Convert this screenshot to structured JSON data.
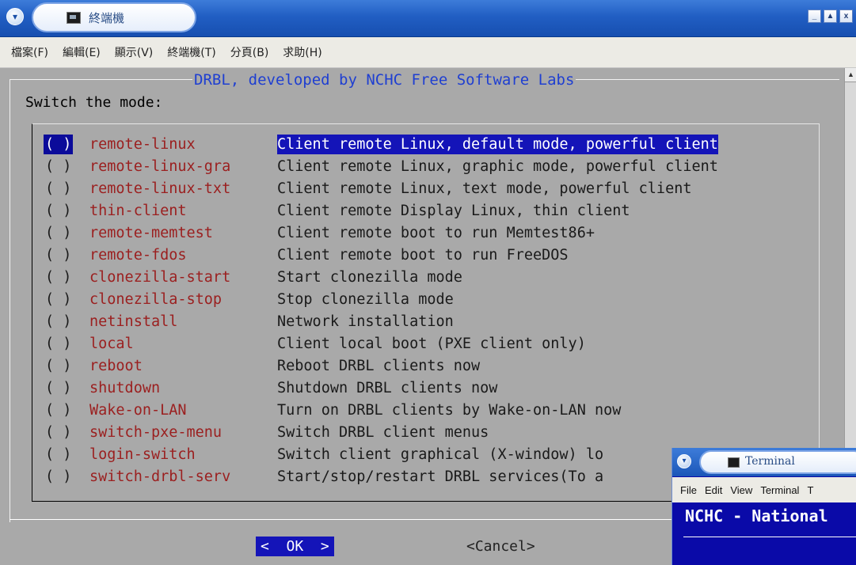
{
  "window": {
    "title": "終端機"
  },
  "menubar": {
    "items": [
      "檔案(F)",
      "編輯(E)",
      "顯示(V)",
      "終端機(T)",
      "分頁(B)",
      "求助(H)"
    ]
  },
  "dialog": {
    "frame_title": "DRBL, developed by NCHC Free Software Labs",
    "prompt": "Switch the mode:",
    "options": [
      {
        "radio": "( )",
        "tag": "remote-linux",
        "desc": "Client remote Linux, default mode, powerful client"
      },
      {
        "radio": "( )",
        "tag": "remote-linux-gra",
        "desc": "Client remote Linux, graphic mode, powerful client"
      },
      {
        "radio": "( )",
        "tag": "remote-linux-txt",
        "desc": "Client remote Linux, text mode, powerful client"
      },
      {
        "radio": "( )",
        "tag": "thin-client",
        "desc": "Client remote Display Linux, thin client"
      },
      {
        "radio": "( )",
        "tag": "remote-memtest",
        "desc": "Client remote boot to run Memtest86+"
      },
      {
        "radio": "( )",
        "tag": "remote-fdos",
        "desc": "Client remote boot to run FreeDOS"
      },
      {
        "radio": "( )",
        "tag": "clonezilla-start",
        "desc": "Start clonezilla mode"
      },
      {
        "radio": "( )",
        "tag": "clonezilla-stop",
        "desc": "Stop clonezilla mode"
      },
      {
        "radio": "( )",
        "tag": "netinstall",
        "desc": "Network installation"
      },
      {
        "radio": "( )",
        "tag": "local",
        "desc": "Client local boot (PXE client only)"
      },
      {
        "radio": "( )",
        "tag": "reboot",
        "desc": "Reboot DRBL clients now"
      },
      {
        "radio": "( )",
        "tag": "shutdown",
        "desc": "Shutdown DRBL clients now"
      },
      {
        "radio": "( )",
        "tag": "Wake-on-LAN",
        "desc": "Turn on DRBL clients by Wake-on-LAN now"
      },
      {
        "radio": "( )",
        "tag": "switch-pxe-menu",
        "desc": "Switch DRBL client menus"
      },
      {
        "radio": "( )",
        "tag": "login-switch",
        "desc": "Switch client graphical (X-window) lo"
      },
      {
        "radio": "( )",
        "tag": "switch-drbl-serv",
        "desc": "Start/stop/restart DRBL services(To a"
      }
    ],
    "ok_label": "<  OK  >",
    "cancel_label": "<Cancel>"
  },
  "second_window": {
    "title": "Terminal",
    "menu": [
      "File",
      "Edit",
      "View",
      "Terminal",
      "T"
    ],
    "line": "NCHC - National"
  },
  "colors": {
    "titlebar": "#215ec3",
    "terminal_bg": "#a9a9a9",
    "highlight": "#1414b8",
    "tag_red": "#9b2020",
    "frame_title_blue": "#1f3fd1"
  }
}
